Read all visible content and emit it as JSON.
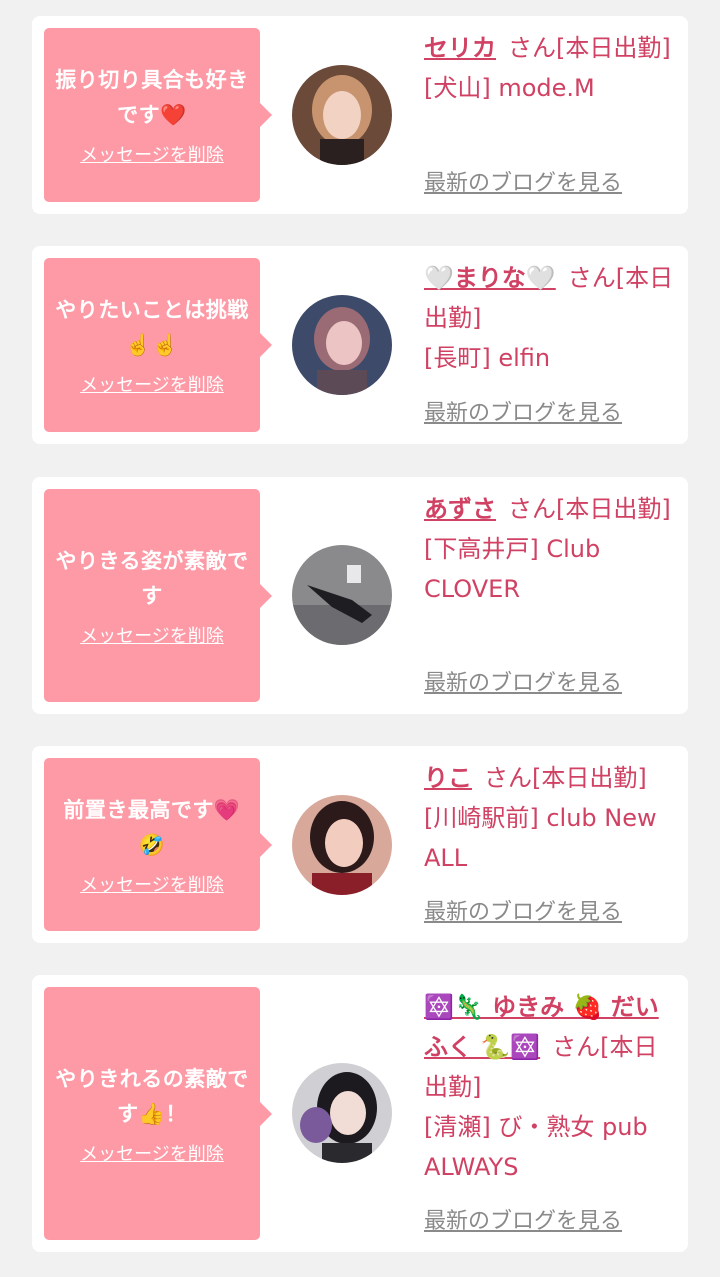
{
  "colors": {
    "background": "#f1f1f1",
    "card": "#ffffff",
    "bubble": "#fd9aa6",
    "name": "#d04163",
    "link": "#8a8a8a"
  },
  "cards": [
    {
      "message": "振り切り具合も好きです❤️",
      "delete_label": "メッセージを削除",
      "name": "セリカ",
      "suffix": "さん[本日出勤]",
      "shop": "[犬山] mode.M",
      "blog_label": "最新のブログを見る",
      "avatar_icon": "avatar-photo"
    },
    {
      "message": "やりたいことは挑戦☝️☝️",
      "delete_label": "メッセージを削除",
      "name": "🤍まりな🤍",
      "suffix": "さん[本日出勤]",
      "shop": "[長町] elfin",
      "blog_label": "最新のブログを見る",
      "avatar_icon": "avatar-photo"
    },
    {
      "message": "やりきる姿が素敵です",
      "delete_label": "メッセージを削除",
      "name": "あずさ",
      "suffix": "さん[本日出勤]",
      "shop": "[下高井戸] Club CLOVER",
      "blog_label": "最新のブログを見る",
      "avatar_icon": "avatar-photo"
    },
    {
      "message": "前置き最高です💗🤣",
      "delete_label": "メッセージを削除",
      "name": "りこ",
      "suffix": "さん[本日出勤]",
      "shop": "[川崎駅前] club New ALL",
      "blog_label": "最新のブログを見る",
      "avatar_icon": "avatar-photo"
    },
    {
      "message": "やりきれるの素敵です👍！",
      "delete_label": "メッセージを削除",
      "name": "🔯🦎 ゆきみ 🍓 だいふく 🐍🔯",
      "suffix": "さん[本日出勤]",
      "shop": "[清瀬] び・熟女 pub ALWAYS",
      "blog_label": "最新のブログを見る",
      "avatar_icon": "avatar-photo"
    }
  ]
}
